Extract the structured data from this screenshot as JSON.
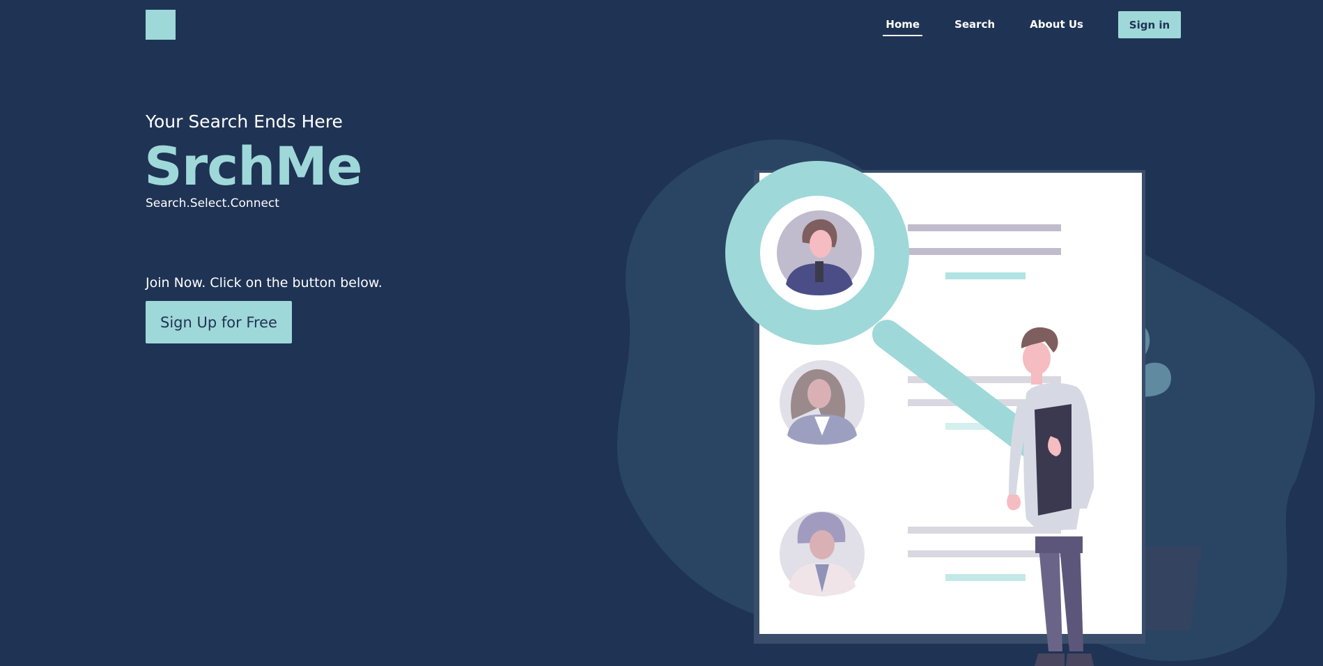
{
  "nav": {
    "links": [
      "Home",
      "Search",
      "About Us"
    ],
    "active": "Home",
    "signin_label": "Sign in"
  },
  "hero": {
    "tagline": "Your Search Ends Here",
    "brand": "SrchMe",
    "motto": "Search.Select.Connect",
    "join_text": "Join Now. Click on the button below.",
    "signup_label": "Sign Up for Free"
  },
  "colors": {
    "background": "#1f3354",
    "accent": "#9fd8d9",
    "blob": "#2a4564",
    "paper": "#ffffff"
  },
  "icons": [
    "logo-square",
    "magnifier-illustration",
    "profile-avatar",
    "plant-illustration"
  ]
}
